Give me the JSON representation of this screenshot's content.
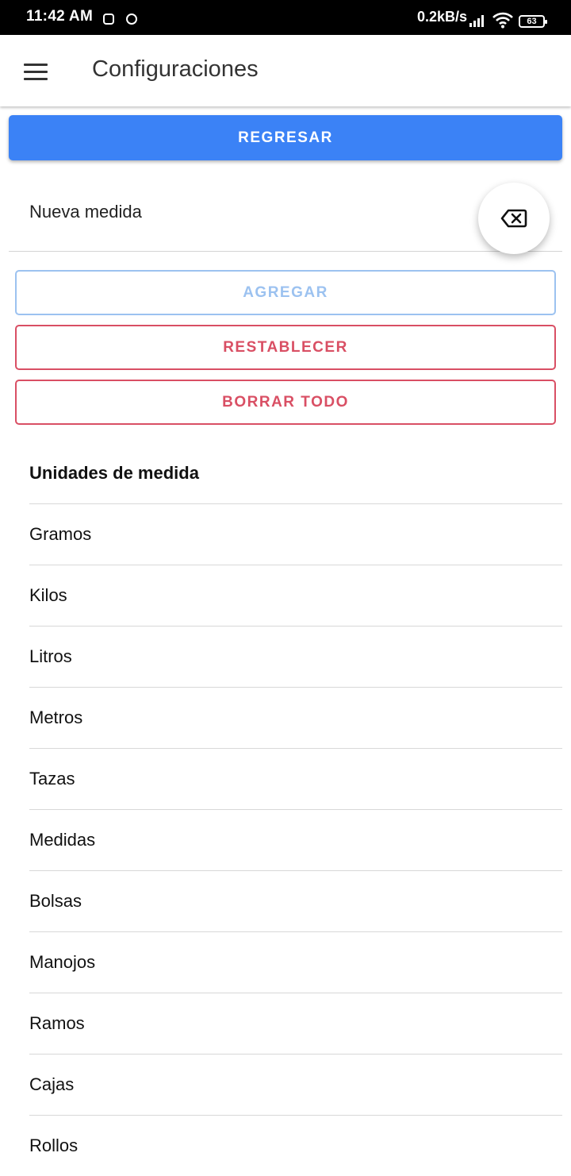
{
  "status_bar": {
    "time": "11:42 AM",
    "speed": "0.2kB/s",
    "battery": "63"
  },
  "app_bar": {
    "title": "Configuraciones",
    "menu_icon": "hamburger-menu-icon"
  },
  "back_button": {
    "label": "REGRESAR"
  },
  "input": {
    "placeholder": "Nueva medida",
    "value": "",
    "clear_icon": "backspace-clear-icon"
  },
  "actions": {
    "add_label": "AGREGAR",
    "reset_label": "RESTABLECER",
    "clear_all_label": "BORRAR TODO"
  },
  "units": {
    "title": "Unidades de medida",
    "items": [
      "Gramos",
      "Kilos",
      "Litros",
      "Metros",
      "Tazas",
      "Medidas",
      "Bolsas",
      "Manojos",
      "Ramos",
      "Cajas",
      "Rollos"
    ]
  },
  "colors": {
    "primary": "#3b82f6",
    "add_disabled": "#9cc2f0",
    "danger": "#d94f64"
  }
}
